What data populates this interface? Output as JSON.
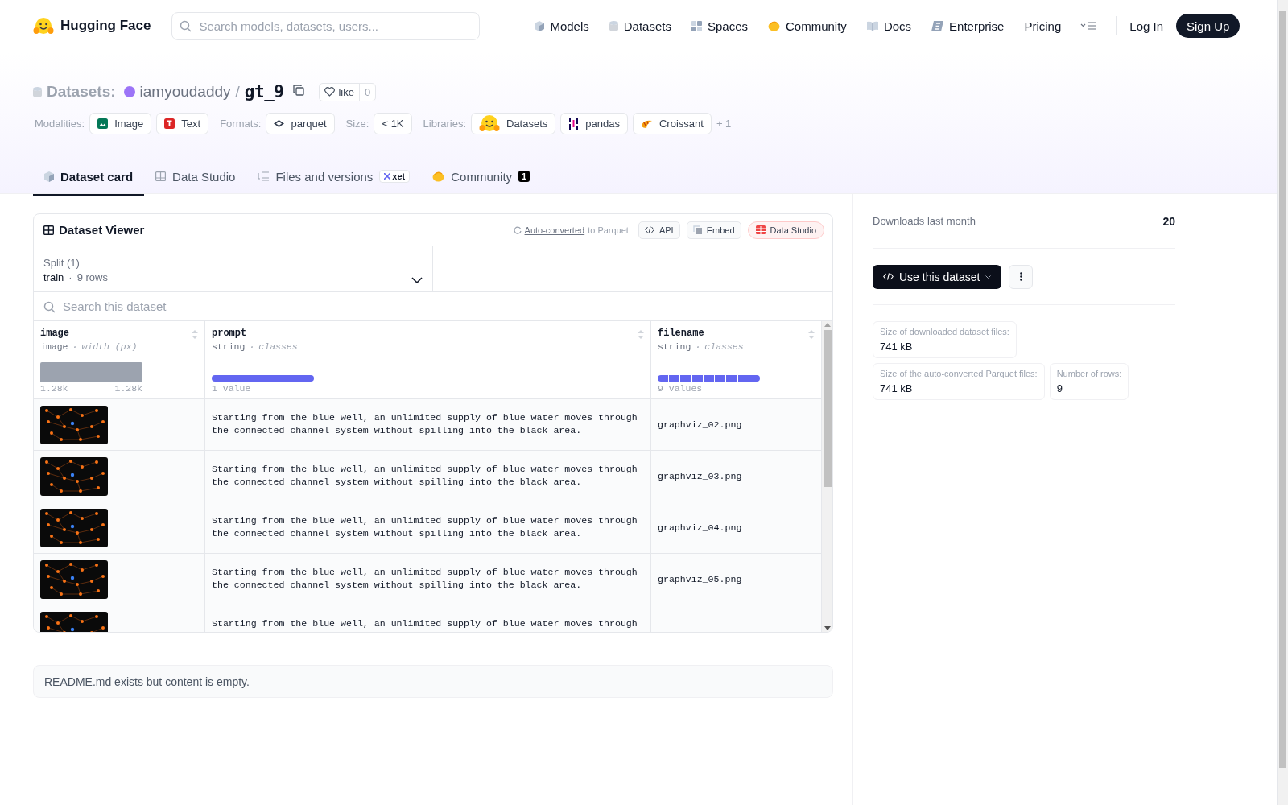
{
  "header": {
    "logo_text": "Hugging Face",
    "search": {
      "placeholder": "Search models, datasets, users..."
    },
    "nav": [
      {
        "label": "Models"
      },
      {
        "label": "Datasets"
      },
      {
        "label": "Spaces"
      },
      {
        "label": "Community"
      },
      {
        "label": "Docs"
      },
      {
        "label": "Enterprise"
      },
      {
        "label": "Pricing"
      }
    ],
    "login": "Log In",
    "signup": "Sign Up"
  },
  "repo": {
    "type_label": "Datasets:",
    "owner": "iamyoudaddy",
    "separator": "/",
    "name": "gt_9",
    "like_label": "like",
    "like_count": "0"
  },
  "tags": [
    {
      "kind": "label",
      "text": "Modalities:"
    },
    {
      "kind": "chip",
      "text": "Image"
    },
    {
      "kind": "chip",
      "text": "Text"
    },
    {
      "kind": "label",
      "text": "Formats:"
    },
    {
      "kind": "chip",
      "text": "parquet"
    },
    {
      "kind": "label",
      "text": "Size:"
    },
    {
      "kind": "chip",
      "text": "< 1K"
    },
    {
      "kind": "label",
      "text": "Libraries:"
    },
    {
      "kind": "chip",
      "text": "Datasets"
    },
    {
      "kind": "chip",
      "text": "pandas"
    },
    {
      "kind": "chip",
      "text": "Croissant"
    },
    {
      "kind": "more",
      "text": "+ 1"
    }
  ],
  "tabs": [
    {
      "label": "Dataset card",
      "selected": true
    },
    {
      "label": "Data Studio",
      "selected": false
    },
    {
      "label": "Files and versions",
      "selected": false,
      "badge": "xet"
    },
    {
      "label": "Community",
      "selected": false,
      "count": "1"
    }
  ],
  "viewer": {
    "title": "Dataset Viewer",
    "converted_link": "Auto-converted",
    "converted_rest": "to Parquet",
    "buttons": [
      {
        "label": "API",
        "kind": "plain"
      },
      {
        "label": "Embed",
        "kind": "plain"
      },
      {
        "label": "Data Studio",
        "kind": "accent"
      }
    ],
    "split": {
      "label": "Split (1)",
      "value": "train",
      "separator": "·",
      "rows": "9 rows"
    },
    "search": {
      "placeholder": "Search this dataset"
    },
    "columns": [
      {
        "name": "image",
        "type": "image",
        "separator": "·",
        "stat": "width (px)",
        "kind": "histogram",
        "bars": [
          {
            "kind": "bin"
          }
        ],
        "labels": [
          "1.28k",
          "1.28k"
        ]
      },
      {
        "name": "prompt",
        "type": "string",
        "separator": "·",
        "stat": "classes",
        "kind": "classes",
        "bars": [
          {
            "kind": "segment"
          }
        ],
        "labels": [
          "1 value"
        ]
      },
      {
        "name": "filename",
        "type": "string",
        "separator": "·",
        "stat": "classes",
        "kind": "classes",
        "bars": [
          {
            "kind": "segment"
          },
          {
            "kind": "segment"
          },
          {
            "kind": "segment"
          },
          {
            "kind": "segment"
          },
          {
            "kind": "segment"
          },
          {
            "kind": "segment"
          },
          {
            "kind": "segment"
          },
          {
            "kind": "segment"
          },
          {
            "kind": "segment"
          }
        ],
        "labels": [
          "9 values"
        ]
      }
    ],
    "rows": [
      {
        "prompt": "Starting from the blue well, an unlimited supply of blue water moves through the connected channel system without spilling into the black area.",
        "filename": "graphviz_02.png"
      },
      {
        "prompt": "Starting from the blue well, an unlimited supply of blue water moves through the connected channel system without spilling into the black area.",
        "filename": "graphviz_03.png"
      },
      {
        "prompt": "Starting from the blue well, an unlimited supply of blue water moves through the connected channel system without spilling into the black area.",
        "filename": "graphviz_04.png"
      },
      {
        "prompt": "Starting from the blue well, an unlimited supply of blue water moves through the connected channel system without spilling into the black area.",
        "filename": "graphviz_05.png"
      },
      {
        "prompt": "Starting from the blue well, an unlimited supply of blue water moves through"
      }
    ]
  },
  "readme": "README.md exists but content is empty.",
  "sidebar": {
    "downloads_label": "Downloads last month",
    "downloads_value": "20",
    "use_button": "Use this dataset",
    "stats": [
      {
        "label": "Size of downloaded dataset files:",
        "value": "741 kB"
      },
      {
        "label": "Size of the auto-converted Parquet files:",
        "value": "741 kB"
      },
      {
        "label": "Number of rows:",
        "value": "9"
      }
    ]
  }
}
